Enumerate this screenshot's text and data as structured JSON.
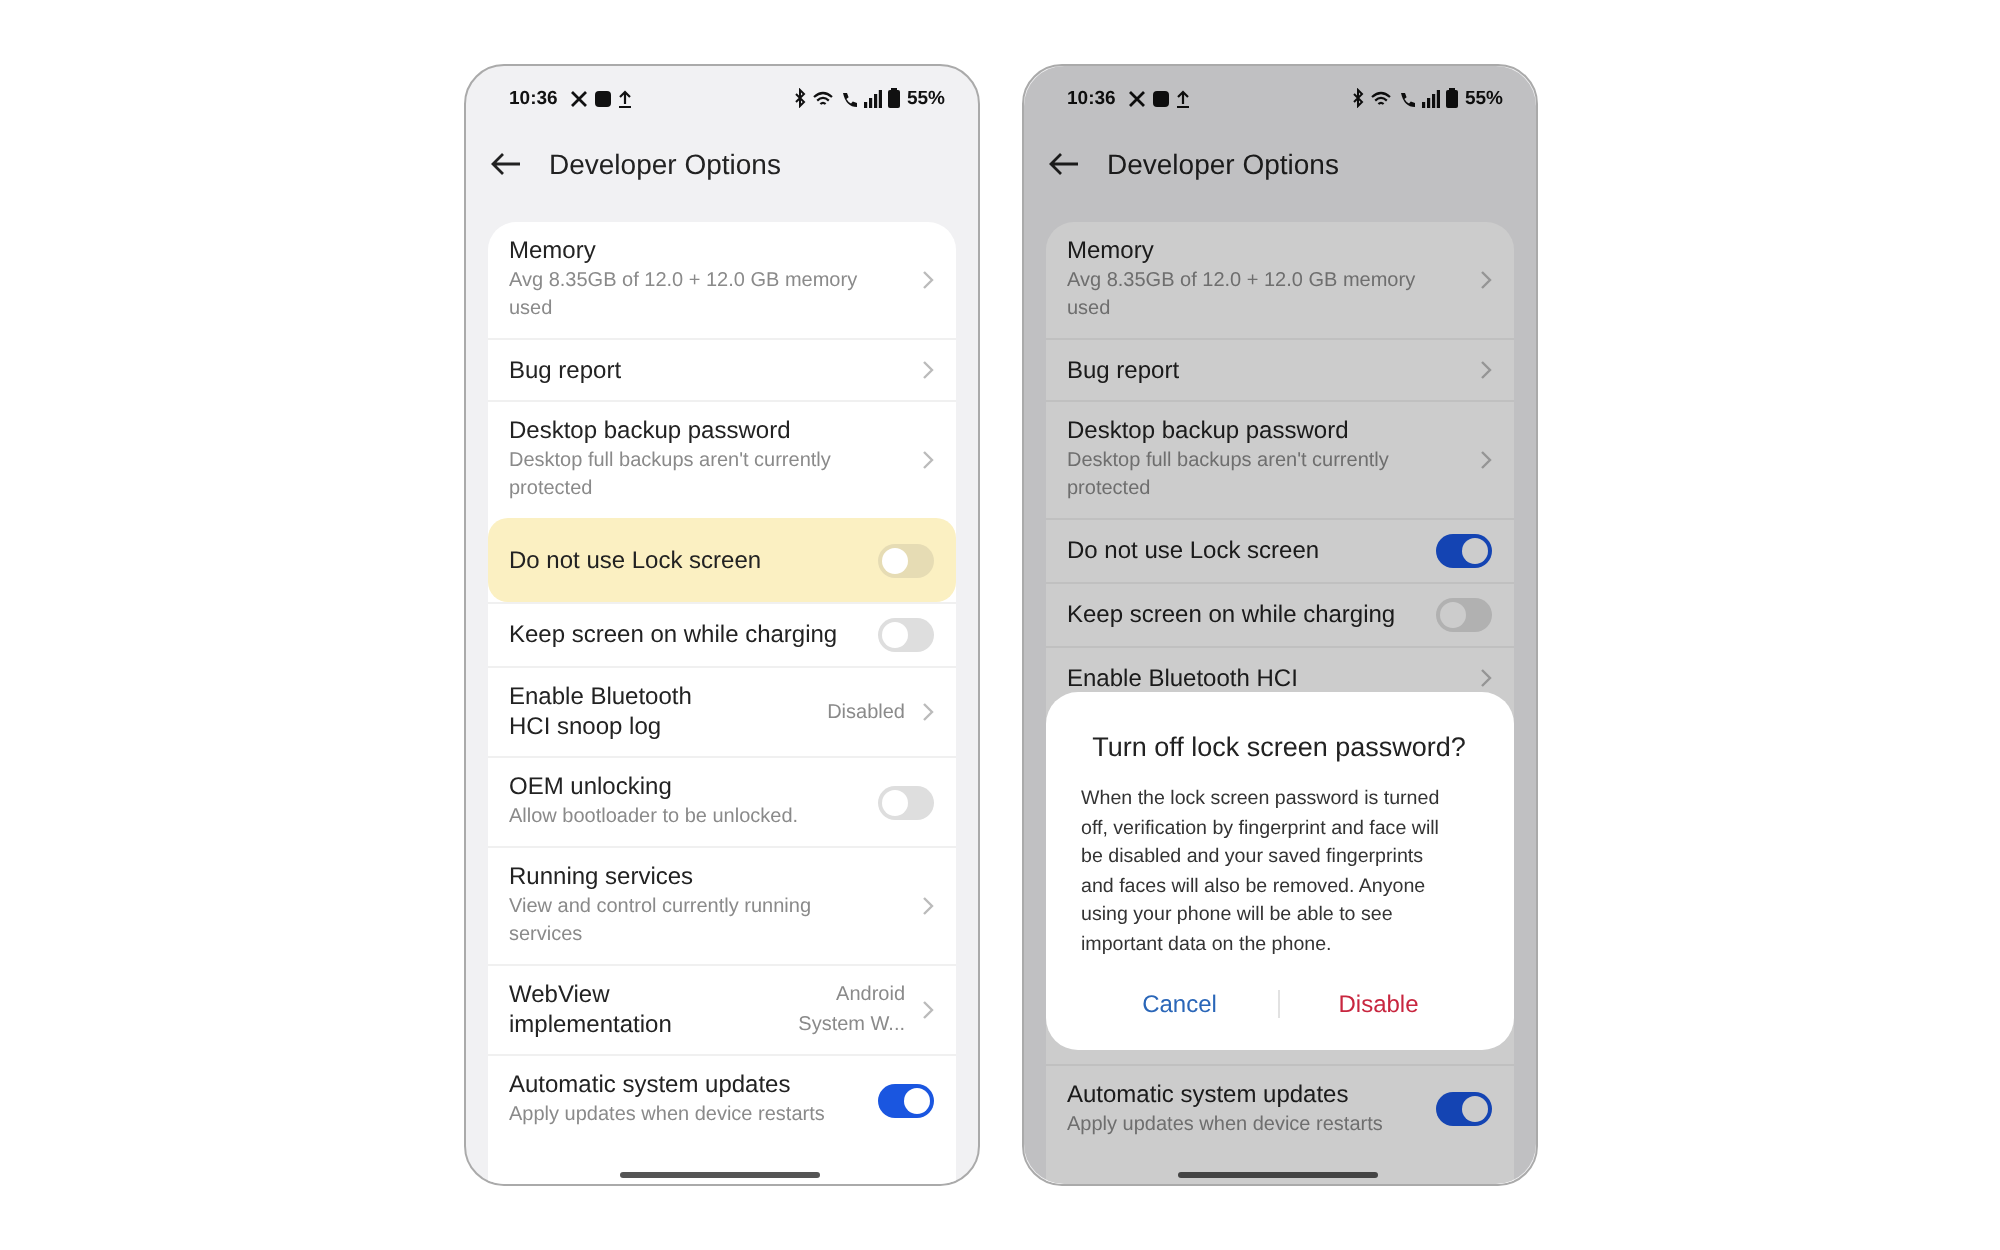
{
  "phones": [
    {
      "dimmed": false,
      "status_bar": {
        "time": "10:36",
        "battery": "55%"
      },
      "header": {
        "title": "Developer Options"
      },
      "items": [
        {
          "kind": "nav",
          "title": "Memory",
          "subtitle": "Avg 8.35GB of 12.0 + 12.0 GB memory used"
        },
        {
          "kind": "nav",
          "title": "Bug report"
        },
        {
          "kind": "nav",
          "title": "Desktop backup password",
          "subtitle": "Desktop full backups aren't currently protected"
        },
        {
          "kind": "toggle",
          "title": "Do not use Lock screen",
          "on": false,
          "highlighted": true
        },
        {
          "kind": "toggle",
          "title": "Keep screen on while charging",
          "on": false,
          "highlighted": false
        },
        {
          "kind": "nav",
          "title": "Enable Bluetooth HCI snoop log",
          "value": "Disabled"
        },
        {
          "kind": "toggle",
          "title": "OEM unlocking",
          "subtitle": "Allow bootloader to be unlocked.",
          "on": false,
          "highlighted": false
        },
        {
          "kind": "nav",
          "title": "Running services",
          "subtitle": "View and control currently running services"
        },
        {
          "kind": "nav",
          "title": "WebView implementation",
          "value": "Android System W..."
        },
        {
          "kind": "toggle",
          "title": "Automatic system updates",
          "subtitle": "Apply updates when device restarts",
          "on": true,
          "highlighted": false
        }
      ]
    },
    {
      "dimmed": true,
      "status_bar": {
        "time": "10:36",
        "battery": "55%"
      },
      "header": {
        "title": "Developer Options"
      },
      "items": [
        {
          "kind": "nav",
          "title": "Memory",
          "subtitle": "Avg 8.35GB of 12.0 + 12.0 GB memory used"
        },
        {
          "kind": "nav",
          "title": "Bug report"
        },
        {
          "kind": "nav",
          "title": "Desktop backup password",
          "subtitle": "Desktop full backups aren't currently protected"
        },
        {
          "kind": "toggle",
          "title": "Do not use Lock screen",
          "on": true,
          "highlighted": false
        },
        {
          "kind": "toggle",
          "title": "Keep screen on while charging",
          "on": false,
          "highlighted": false
        },
        {
          "kind": "nav",
          "title": "Enable Bluetooth HCI"
        },
        {
          "kind": "dialog",
          "title": "Turn off lock screen password?",
          "message": "When the lock screen password is turned off, verification by fingerprint and face will be disabled and your saved fingerprints and faces will also be removed. Anyone using your phone will be able to see important data on the phone.",
          "buttons": [
            {
              "label": "Cancel",
              "kind": "cancel"
            },
            {
              "label": "Disable",
              "kind": "destructive"
            }
          ]
        },
        {
          "kind": "toggle",
          "title": "Automatic system updates",
          "subtitle": "Apply updates when device restarts",
          "on": true,
          "highlighted": false
        }
      ]
    }
  ]
}
